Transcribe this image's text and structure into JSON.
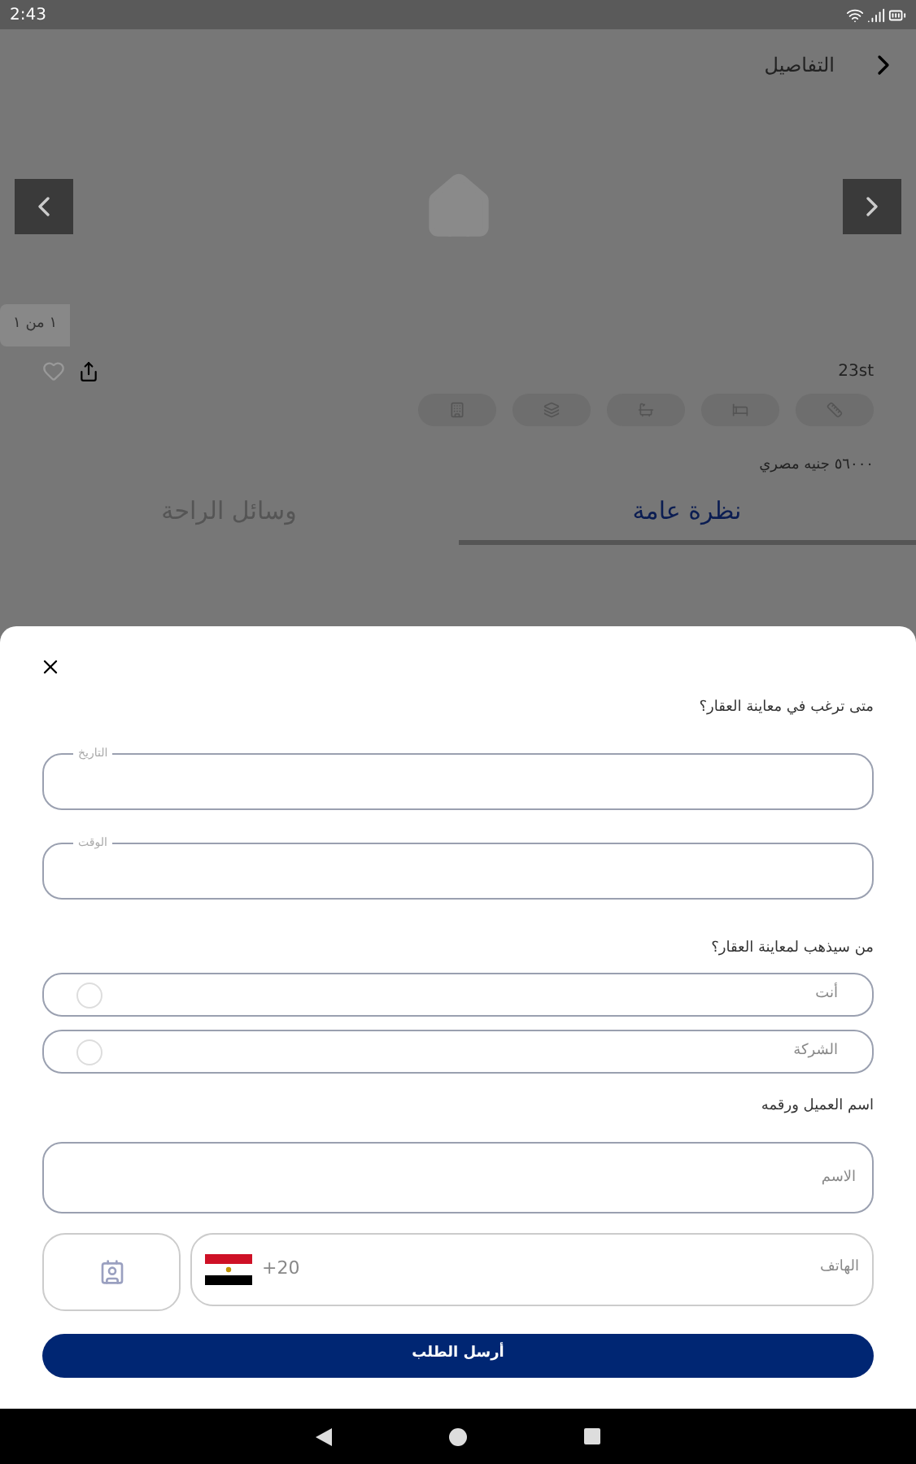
{
  "status_bar": {
    "time": "2:43"
  },
  "header": {
    "title": "التفاصيل"
  },
  "gallery": {
    "counter": "١ من ١"
  },
  "listing": {
    "name": "23st",
    "favorite": false,
    "chips": [
      {
        "kind": "area"
      },
      {
        "kind": "bed"
      },
      {
        "kind": "bath"
      },
      {
        "kind": "floor"
      },
      {
        "kind": "type"
      }
    ],
    "price": "٥٦٠٠٠ جنيه مصري"
  },
  "tabs": [
    {
      "label": "نظرة عامة",
      "selected": true
    },
    {
      "label": "وسائل الراحة",
      "selected": false
    }
  ],
  "sheet": {
    "question_when": "متى ترغب في معاينة العقار؟",
    "date_field": {
      "label": "التاريخ"
    },
    "time_field": {
      "label": "الوقت"
    },
    "question_who": "من سيذهب لمعاينة العقار؟",
    "options": [
      {
        "label": "أنت",
        "selected": false
      },
      {
        "label": "الشركة",
        "selected": false
      }
    ],
    "client_label": "اسم العميل ورقمه",
    "name_field": {
      "placeholder": "الاسم"
    },
    "phone_field": {
      "placeholder": "الهاتف",
      "code": "+20"
    },
    "submit": "أرسل الطلب"
  }
}
